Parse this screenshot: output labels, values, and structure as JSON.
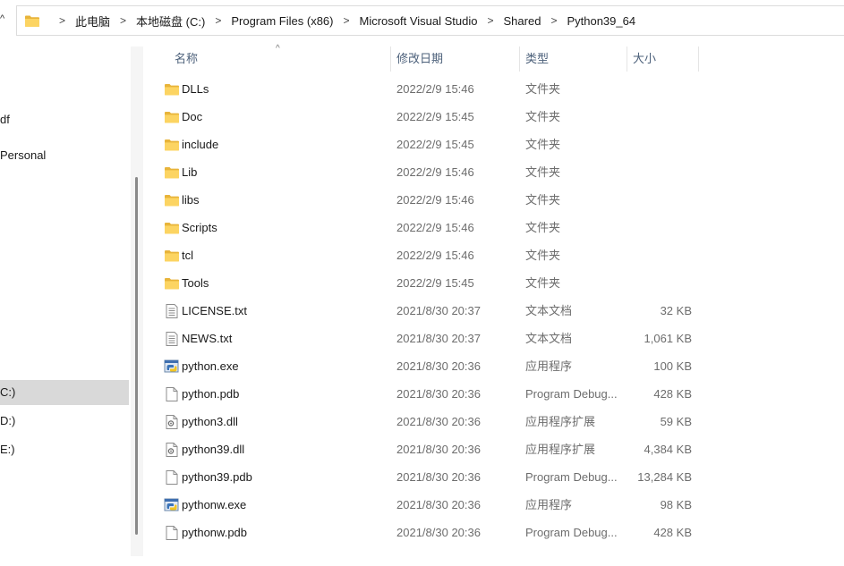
{
  "breadcrumb": [
    "此电脑",
    "本地磁盘 (C:)",
    "Program Files (x86)",
    "Microsoft Visual Studio",
    "Shared",
    "Python39_64"
  ],
  "sidebar": {
    "items": [
      {
        "label": "df"
      },
      {
        "label": "Personal"
      },
      {
        "label": "C:)"
      },
      {
        "label": "D:)"
      },
      {
        "label": "E:)"
      }
    ]
  },
  "columns": {
    "name": "名称",
    "date": "修改日期",
    "type": "类型",
    "size": "大小"
  },
  "files": [
    {
      "name": "DLLs",
      "date": "2022/2/9 15:46",
      "type": "文件夹",
      "size": "",
      "icon": "folder-icon"
    },
    {
      "name": "Doc",
      "date": "2022/2/9 15:45",
      "type": "文件夹",
      "size": "",
      "icon": "folder-icon"
    },
    {
      "name": "include",
      "date": "2022/2/9 15:45",
      "type": "文件夹",
      "size": "",
      "icon": "folder-icon"
    },
    {
      "name": "Lib",
      "date": "2022/2/9 15:46",
      "type": "文件夹",
      "size": "",
      "icon": "folder-icon"
    },
    {
      "name": "libs",
      "date": "2022/2/9 15:46",
      "type": "文件夹",
      "size": "",
      "icon": "folder-icon"
    },
    {
      "name": "Scripts",
      "date": "2022/2/9 15:46",
      "type": "文件夹",
      "size": "",
      "icon": "folder-icon"
    },
    {
      "name": "tcl",
      "date": "2022/2/9 15:46",
      "type": "文件夹",
      "size": "",
      "icon": "folder-icon"
    },
    {
      "name": "Tools",
      "date": "2022/2/9 15:45",
      "type": "文件夹",
      "size": "",
      "icon": "folder-icon"
    },
    {
      "name": "LICENSE.txt",
      "date": "2021/8/30 20:37",
      "type": "文本文档",
      "size": "32 KB",
      "icon": "text-file-icon"
    },
    {
      "name": "NEWS.txt",
      "date": "2021/8/30 20:37",
      "type": "文本文档",
      "size": "1,061 KB",
      "icon": "text-file-icon"
    },
    {
      "name": "python.exe",
      "date": "2021/8/30 20:36",
      "type": "应用程序",
      "size": "100 KB",
      "icon": "python-exe-icon"
    },
    {
      "name": "python.pdb",
      "date": "2021/8/30 20:36",
      "type": "Program Debug...",
      "size": "428 KB",
      "icon": "blank-file-icon"
    },
    {
      "name": "python3.dll",
      "date": "2021/8/30 20:36",
      "type": "应用程序扩展",
      "size": "59 KB",
      "icon": "dll-file-icon"
    },
    {
      "name": "python39.dll",
      "date": "2021/8/30 20:36",
      "type": "应用程序扩展",
      "size": "4,384 KB",
      "icon": "dll-file-icon"
    },
    {
      "name": "python39.pdb",
      "date": "2021/8/30 20:36",
      "type": "Program Debug...",
      "size": "13,284 KB",
      "icon": "blank-file-icon"
    },
    {
      "name": "pythonw.exe",
      "date": "2021/8/30 20:36",
      "type": "应用程序",
      "size": "98 KB",
      "icon": "python-exe-icon"
    },
    {
      "name": "pythonw.pdb",
      "date": "2021/8/30 20:36",
      "type": "Program Debug...",
      "size": "428 KB",
      "icon": "blank-file-icon"
    }
  ]
}
